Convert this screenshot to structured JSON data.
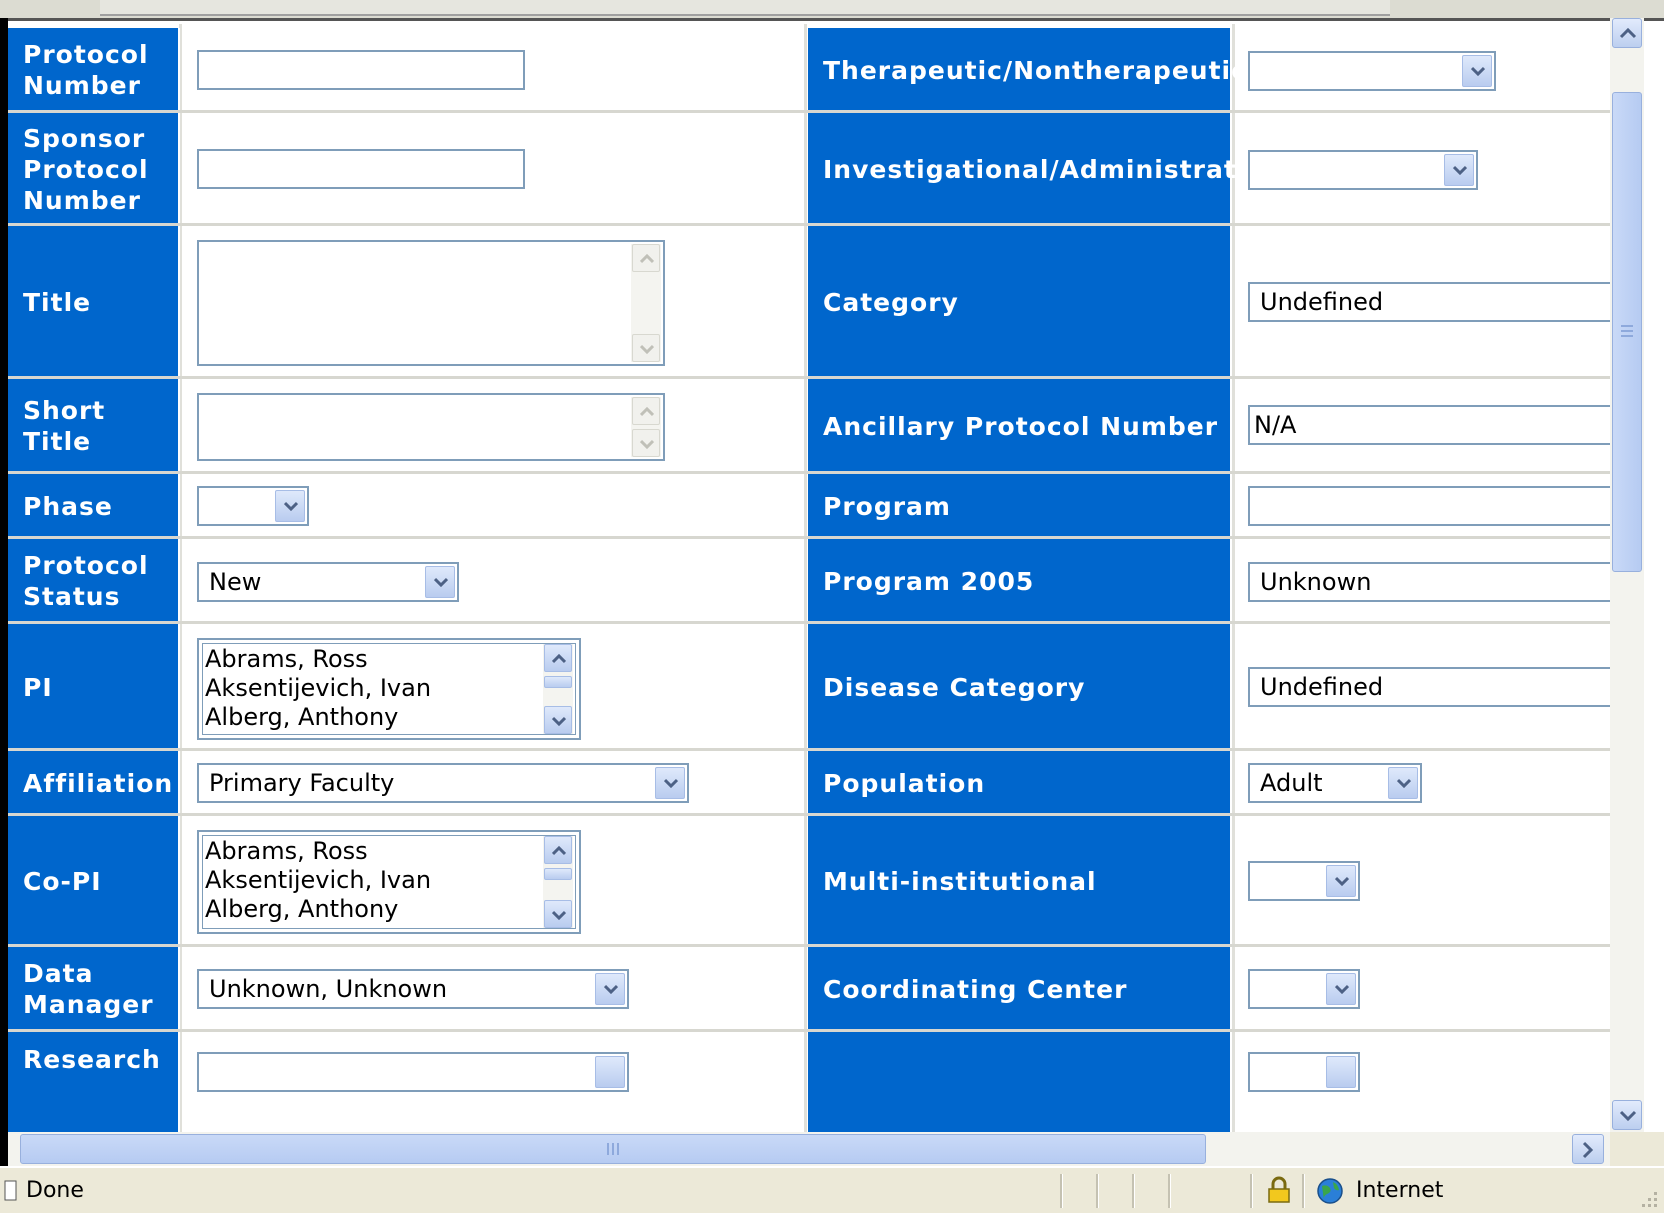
{
  "form": {
    "left": {
      "protocol_number": "Protocol Number",
      "sponsor_protocol_number": "Sponsor Protocol Number",
      "title": "Title",
      "short_title": "Short Title",
      "phase": "Phase",
      "protocol_status": "Protocol Status",
      "protocol_status_value": "New",
      "pi": "PI",
      "affiliation": "Affiliation",
      "affiliation_value": "Primary Faculty",
      "co_pi": "Co-PI",
      "data_manager": "Data Manager",
      "data_manager_value": "Unknown, Unknown",
      "research": "Research"
    },
    "right": {
      "therapeutic": "Therapeutic/Nontherapeutic",
      "investigational": "Investigational/Administrative",
      "category": "Category",
      "category_value": "Undefined",
      "ancillary": "Ancillary Protocol Number",
      "ancillary_value": "N/A",
      "program": "Program",
      "program_2005": "Program 2005",
      "program_2005_value": "Unknown",
      "disease_category": "Disease Category",
      "disease_category_value": "Undefined",
      "population": "Population",
      "population_value": "Adult",
      "multi_institutional": "Multi-institutional",
      "coordinating_center": "Coordinating Center"
    },
    "pi_list": [
      "Abrams, Ross",
      "Aksentijevich, Ivan",
      "Alberg, Anthony"
    ],
    "copi_list": [
      "Abrams, Ross",
      "Aksentijevich, Ivan",
      "Alberg, Anthony"
    ]
  },
  "statusbar": {
    "text": "Done",
    "zone": "Internet"
  },
  "colors": {
    "label_bg": "#0066cc",
    "input_border": "#7f9db9"
  }
}
